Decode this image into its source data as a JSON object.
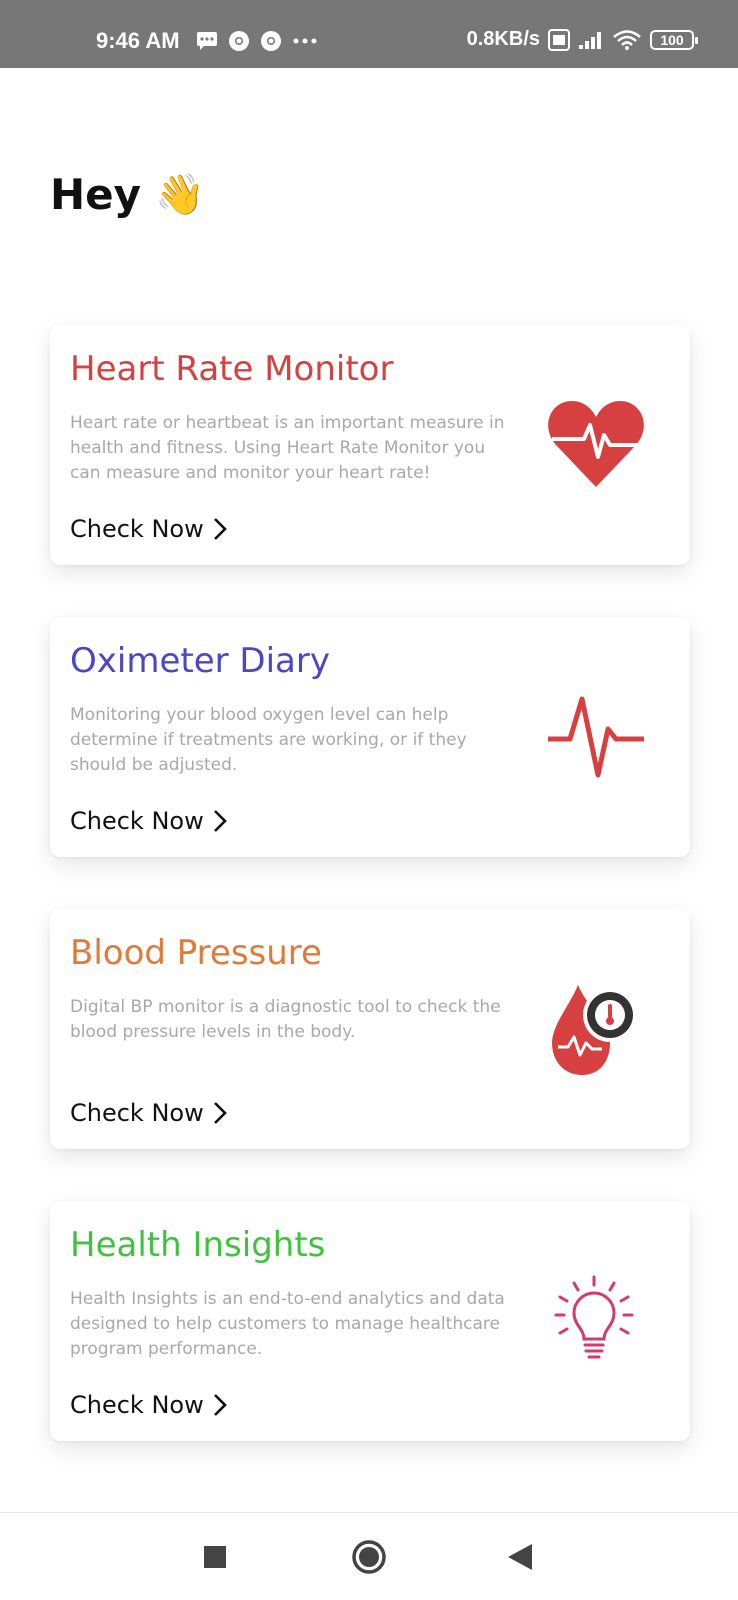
{
  "status_bar": {
    "time": "9:46 AM",
    "speed": "0.8KB/s",
    "battery": "100"
  },
  "greeting": {
    "text": "Hey",
    "emoji": "👋"
  },
  "cards": [
    {
      "title": "Heart Rate Monitor",
      "color": "#d64040",
      "description": "Heart rate or heartbeat is an important measure in health and fitness. Using Heart Rate Monitor you can measure and monitor your heart rate!",
      "cta": "Check Now",
      "icon": "heart-pulse-icon"
    },
    {
      "title": "Oximeter Diary",
      "color": "#4a46c8",
      "description": "Monitoring your blood oxygen level can help determine if treatments are working, or if they should be adjusted.",
      "cta": "Check Now",
      "icon": "pulse-line-icon"
    },
    {
      "title": "Blood Pressure",
      "color": "#e07a3a",
      "description": "Digital BP monitor is a diagnostic tool to check the blood pressure levels in the body.",
      "cta": "Check Now",
      "icon": "blood-drop-gauge-icon"
    },
    {
      "title": "Health Insights",
      "color": "#3fc33f",
      "description": "Health Insights is an end-to-end analytics and data designed to help customers to manage healthcare program performance.",
      "cta": "Check Now",
      "icon": "lightbulb-icon"
    }
  ],
  "nav": {
    "recents": "recents-icon",
    "home": "home-icon",
    "back": "back-icon"
  }
}
